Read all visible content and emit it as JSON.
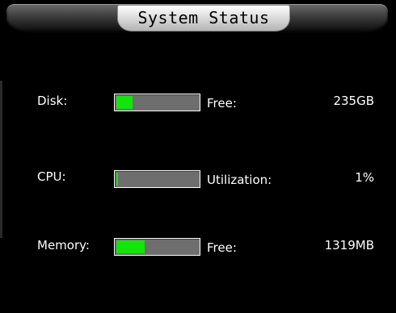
{
  "header": {
    "title": "System Status"
  },
  "metrics": [
    {
      "label": "Disk:",
      "desc": "Free:",
      "value": "235GB",
      "level": 0.2
    },
    {
      "label": "CPU:",
      "desc": "Utilization:",
      "value": "1%",
      "level": 0.01
    },
    {
      "label": "Memory:",
      "desc": "Free:",
      "value": "1319MB",
      "level": 0.35
    }
  ],
  "colors": {
    "bar_fill": "#14e40c",
    "bar_track": "#6e6e6e",
    "background": "#000000"
  }
}
